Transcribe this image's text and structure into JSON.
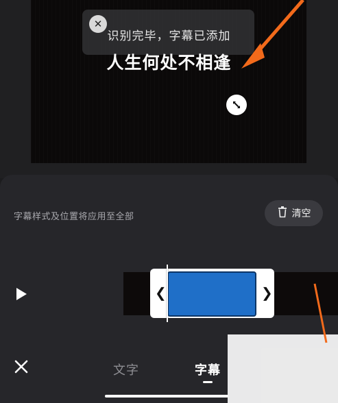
{
  "preview": {
    "toast_text": "识别完毕，字幕已添加",
    "subtitle_text": "人生何处不相逢"
  },
  "panel": {
    "hint": "字幕样式及位置将应用至全部",
    "clear_label": "清空"
  },
  "tabs": [
    {
      "label": "文字",
      "active": false
    },
    {
      "label": "字幕",
      "active": true
    }
  ],
  "timeline": {
    "left_handle": "❮",
    "right_handle": "❯",
    "clip_color": "#1f6fc8"
  },
  "colors": {
    "annotation_arrow": "#f26a1b",
    "background": "#1c1c1e",
    "panel": "#26262a"
  },
  "icons": [
    "close-icon",
    "resize-icon",
    "trash-icon",
    "play-icon"
  ]
}
